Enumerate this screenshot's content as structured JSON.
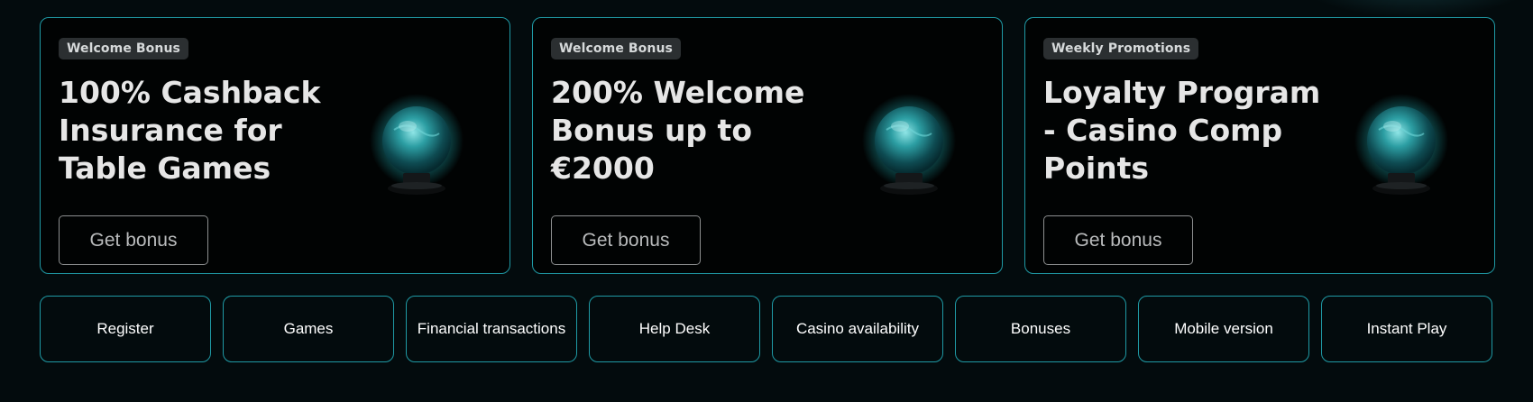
{
  "promotions": [
    {
      "badge": "Welcome Bonus",
      "title": "100% Cashback Insurance for Table Games",
      "button": "Get bonus",
      "icon": "crystal-ball-icon"
    },
    {
      "badge": "Welcome Bonus",
      "title": "200% Welcome Bonus up to €2000",
      "button": "Get bonus",
      "icon": "crystal-ball-icon"
    },
    {
      "badge": "Weekly Promotions",
      "title": "Loyalty Program - Casino Comp Points",
      "button": "Get bonus",
      "icon": "crystal-ball-icon"
    }
  ],
  "quick_links": [
    {
      "label": "Register"
    },
    {
      "label": "Games"
    },
    {
      "label": "Financial transactions"
    },
    {
      "label": "Help Desk"
    },
    {
      "label": "Casino availability"
    },
    {
      "label": "Bonuses"
    },
    {
      "label": "Mobile version"
    },
    {
      "label": "Instant Play"
    }
  ],
  "colors": {
    "background": "#030b0d",
    "accent_border": "#1f9aa5",
    "badge_bg": "#2b2f31",
    "title_text": "#e6e6e6",
    "orb_glow": "#1fb3b8"
  }
}
